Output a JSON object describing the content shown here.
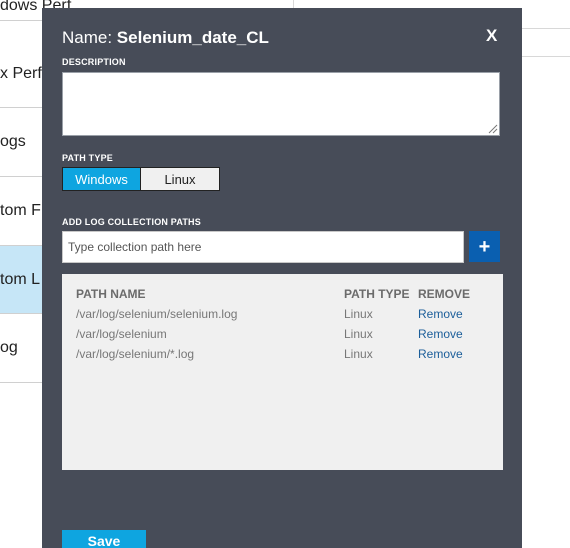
{
  "background_list": {
    "items": [
      {
        "label": "dows Perf...",
        "selected": false
      },
      {
        "label": "x Perf",
        "selected": false
      },
      {
        "label": "ogs",
        "selected": false
      },
      {
        "label": "tom F",
        "selected": false
      },
      {
        "label": "tom L",
        "selected": true
      },
      {
        "label": "og",
        "selected": false
      }
    ]
  },
  "dialog": {
    "title_prefix": "Name: ",
    "title_name": "Selenium_date_CL",
    "close_label": "X",
    "description": {
      "label": "DESCRIPTION",
      "value": ""
    },
    "path_type": {
      "label": "PATH TYPE",
      "options": [
        "Windows",
        "Linux"
      ],
      "selected": "Windows"
    },
    "collection_paths": {
      "label": "ADD LOG COLLECTION PATHS",
      "placeholder": "Type collection path here",
      "add_label": "+"
    },
    "table": {
      "headers": {
        "path_name": "PATH NAME",
        "path_type": "PATH TYPE",
        "remove": "REMOVE"
      },
      "rows": [
        {
          "path": "/var/log/selenium/selenium.log",
          "type": "Linux",
          "action": "Remove"
        },
        {
          "path": "/var/log/selenium",
          "type": "Linux",
          "action": "Remove"
        },
        {
          "path": "/var/log/selenium/*.log",
          "type": "Linux",
          "action": "Remove"
        }
      ]
    },
    "save_label": "Save"
  },
  "colors": {
    "dialog_bg": "#474c58",
    "accent": "#0ea5e0",
    "add_button": "#0a5fb0",
    "link": "#1c5e9a",
    "selected_row": "#c6e6f7"
  }
}
